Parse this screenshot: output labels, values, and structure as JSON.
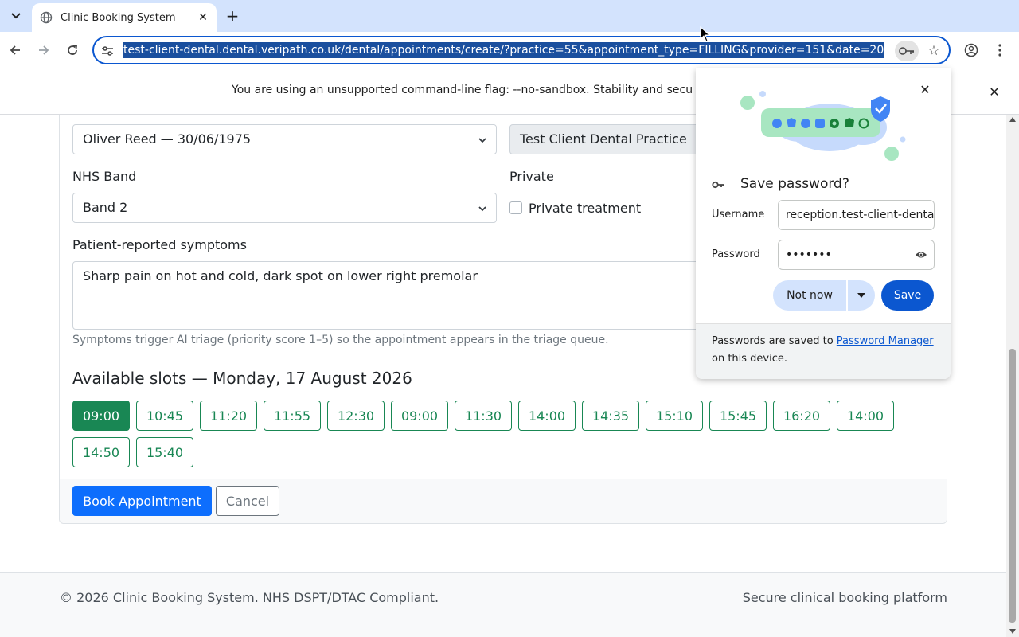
{
  "browser": {
    "tab_title": "Clinic Booking System",
    "url": "test-client-dental.dental.veripath.co.uk/dental/appointments/create/?practice=55&appointment_type=FILLING&provider=151&date=20",
    "infobar_text": "You are using an unsupported command-line flag: --no-sandbox. Stability and secu"
  },
  "form": {
    "patient_select": "Oliver Reed — 30/06/1975",
    "practice_value": "Test Client Dental Practice",
    "nhs_band_label": "NHS Band",
    "nhs_band_value": "Band 2",
    "private_label": "Private",
    "private_checkbox_label": "Private treatment",
    "private_checked": false,
    "symptoms_label": "Patient-reported symptoms",
    "symptoms_value": "Sharp pain on hot and cold, dark spot on lower right premolar",
    "symptoms_help": "Symptoms trigger AI triage (priority score 1–5) so the appointment appears in the triage queue.",
    "slots_heading": "Available slots — Monday, 17 August 2026",
    "slots": [
      "09:00",
      "10:45",
      "11:20",
      "11:55",
      "12:30",
      "09:00",
      "11:30",
      "14:00",
      "14:35",
      "15:10",
      "15:45",
      "16:20",
      "14:00",
      "14:50",
      "15:40"
    ],
    "selected_slot_index": 0,
    "book_button": "Book Appointment",
    "cancel_button": "Cancel"
  },
  "footer": {
    "left": "© 2026 Clinic Booking System. NHS DSPT/DTAC Compliant.",
    "right": "Secure clinical booking platform"
  },
  "password_bubble": {
    "title": "Save password?",
    "username_label": "Username",
    "username_value": "reception.test-client-dental",
    "password_label": "Password",
    "password_value": "•••••••",
    "not_now": "Not now",
    "save": "Save",
    "footer_prefix": "Passwords are saved to",
    "footer_link": "Password Manager",
    "footer_suffix": "on this device."
  },
  "colors": {
    "primary": "#0d6efd",
    "success": "#198754",
    "chrome_blue": "#0b57d0",
    "tabbar": "#d3e3fd"
  }
}
